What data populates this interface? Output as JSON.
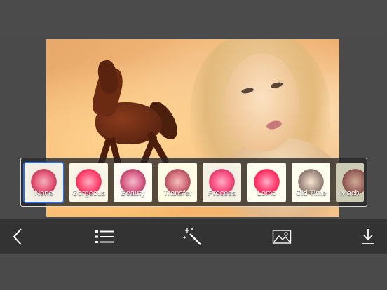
{
  "filters": {
    "items": [
      {
        "label": "None",
        "selected": true
      },
      {
        "label": "Gorgeous",
        "selected": false
      },
      {
        "label": "Beauty",
        "selected": false
      },
      {
        "label": "Transfer",
        "selected": false
      },
      {
        "label": "Process",
        "selected": false
      },
      {
        "label": "Lomo",
        "selected": false
      },
      {
        "label": "Old Time",
        "selected": false
      },
      {
        "label": "Moch",
        "selected": false
      }
    ]
  },
  "toolbar": {
    "buttons": [
      {
        "icon": "back-chevron-icon"
      },
      {
        "icon": "list-icon"
      },
      {
        "icon": "magic-wand-icon"
      },
      {
        "icon": "image-icon"
      },
      {
        "icon": "download-icon"
      }
    ]
  },
  "colors": {
    "accent_selected": "#2d6fe6",
    "toolbar_bg": "#333333",
    "background": "#4a4a4a"
  }
}
